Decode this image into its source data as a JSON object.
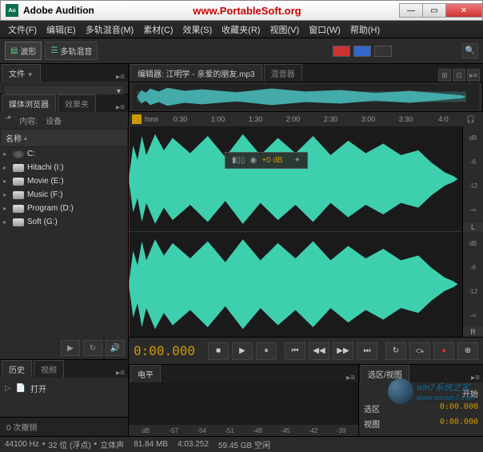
{
  "titlebar": {
    "app_icon_text": "Au",
    "title": "Adobe Audition",
    "url": "www.PortableSoft.org"
  },
  "menu": {
    "file": "文件(F)",
    "edit": "编辑(E)",
    "multitrack": "多轨混音(M)",
    "clip": "素材(C)",
    "effects": "效果(S)",
    "favorites": "收藏夹(R)",
    "view": "视图(V)",
    "window": "窗口(W)",
    "help": "帮助(H)"
  },
  "toolbar": {
    "waveform": "波形",
    "multitrack": "多轨混音"
  },
  "left": {
    "file_tab": "文件",
    "media_browser_tab": "媒体浏览器",
    "effects_tab": "效果夹",
    "content_label": "内容:",
    "devices_label": "设备",
    "name_header": "名称",
    "drives": [
      {
        "label": "C:",
        "icon": "disk"
      },
      {
        "label": "Hitachi (I:)",
        "icon": "drive"
      },
      {
        "label": "Movie (E:)",
        "icon": "drive"
      },
      {
        "label": "Music (F:)",
        "icon": "drive"
      },
      {
        "label": "Program (D:)",
        "icon": "drive"
      },
      {
        "label": "Soft (G:)",
        "icon": "drive"
      }
    ],
    "history_tab": "历史",
    "video_tab": "视频",
    "open_label": "打开",
    "undo_count": "0 次撤销"
  },
  "editor": {
    "tab_prefix": "编辑器:",
    "filename": "江明学 - 亲爱的朋友.mp3",
    "mixer_tab": "混音器",
    "hms_label": "hms",
    "time_marks": [
      "0:30",
      "1:00",
      "1:30",
      "2:00",
      "2:30",
      "3:00",
      "3:30",
      "4:0"
    ],
    "db_label": "dB",
    "db_marks": [
      "-6",
      "-12",
      "-∞",
      "-12",
      "-6"
    ],
    "channel_l": "L",
    "channel_r": "R",
    "hud_gain": "+0 dB",
    "timecode": "0:00.000"
  },
  "levels": {
    "tab": "电平",
    "scale_prefix": "dB",
    "marks": [
      "-57",
      "-54",
      "-51",
      "-48",
      "-45",
      "-42",
      "-39"
    ]
  },
  "selection": {
    "tab": "选区/视图",
    "start_header": "开始",
    "sel_label": "选区",
    "sel_val": "0:00.000",
    "view_label": "视图",
    "view_val": "0:00.000"
  },
  "status": {
    "sample_rate": "44100 Hz",
    "bit_depth": "32 位 (浮点)",
    "channels": "立体声",
    "size": "81.84 MB",
    "duration": "4:03.252",
    "disk_free": "59.45 GB 空闲"
  },
  "watermark": {
    "text": "win7系统之家",
    "url": "www.winwin7.com"
  }
}
